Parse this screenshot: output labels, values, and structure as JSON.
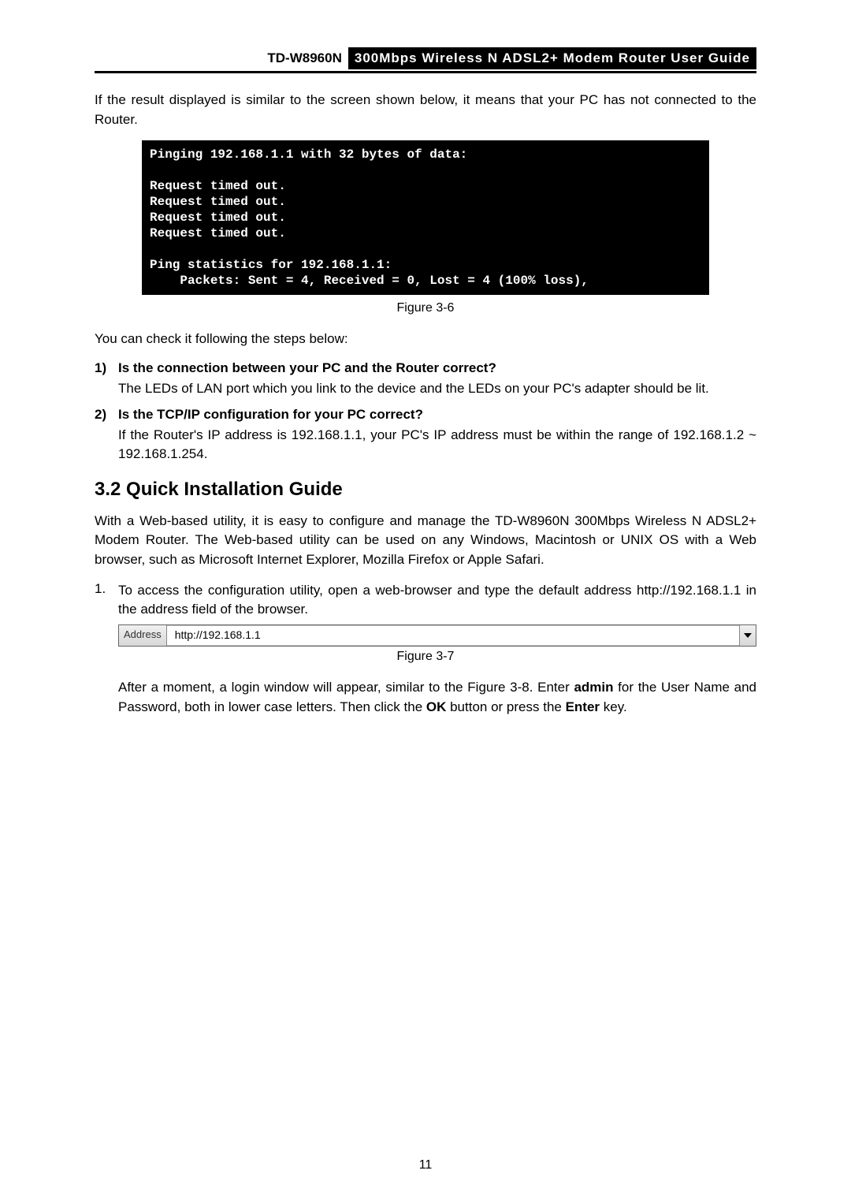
{
  "header": {
    "model": "TD-W8960N",
    "title": "300Mbps Wireless N ADSL2+ Modem Router User Guide"
  },
  "intro": "If the result displayed is similar to the screen shown below, it means that your PC has not connected to the Router.",
  "terminal_lines": [
    "Pinging 192.168.1.1 with 32 bytes of data:",
    "",
    "Request timed out.",
    "Request timed out.",
    "Request timed out.",
    "Request timed out.",
    "",
    "Ping statistics for 192.168.1.1:",
    "    Packets: Sent = 4, Received = 0, Lost = 4 (100% loss),"
  ],
  "fig1": "Figure 3-6",
  "check_intro": "You can check it following the steps below:",
  "steps": [
    {
      "num": "1)",
      "q": "Is the connection between your PC and the Router correct?",
      "body": "The LEDs of LAN port which you link to the device and the LEDs on your PC's adapter should be lit."
    },
    {
      "num": "2)",
      "q": "Is the TCP/IP configuration for your PC correct?",
      "body": "If the Router's IP address is 192.168.1.1, your PC's IP address must be within the range of 192.168.1.2 ~ 192.168.1.254."
    }
  ],
  "section": "3.2  Quick Installation Guide",
  "section_intro": "With a Web-based utility, it is easy to configure and manage the TD-W8960N 300Mbps Wireless N ADSL2+ Modem Router. The Web-based utility can be used on any Windows, Macintosh or UNIX OS with a Web browser, such as Microsoft Internet Explorer, Mozilla Firefox or Apple Safari.",
  "numbered": {
    "n": "1.",
    "body": "To access the configuration utility, open a web-browser and type the default address http://192.168.1.1 in the address field of the browser."
  },
  "addrbar": {
    "label": "Address",
    "value": "http://192.168.1.1"
  },
  "fig2": "Figure 3-7",
  "after": {
    "pre": "After a moment, a login window will appear, similar to the Figure 3-8. Enter ",
    "admin": "admin",
    "mid": " for the User Name and Password, both in lower case letters. Then click the ",
    "ok": "OK",
    "mid2": " button or press the ",
    "enter": "Enter",
    "post": " key."
  },
  "page_number": "11"
}
